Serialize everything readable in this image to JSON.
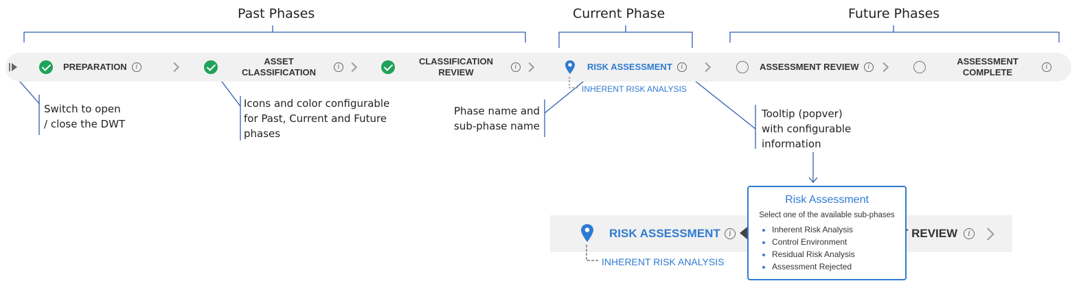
{
  "groups": {
    "past": "Past Phases",
    "current": "Current Phase",
    "future": "Future Phases"
  },
  "phases": [
    {
      "lines": [
        "PREPARATION"
      ],
      "status": "complete"
    },
    {
      "lines": [
        "ASSET",
        "CLASSIFICATION"
      ],
      "status": "complete"
    },
    {
      "lines": [
        "CLASSIFICATION",
        "REVIEW"
      ],
      "status": "complete"
    },
    {
      "lines": [
        "RISK ASSESSMENT"
      ],
      "status": "current",
      "sub_phase": "INHERENT RISK ANALYSIS"
    },
    {
      "lines": [
        "ASSESSMENT REVIEW"
      ],
      "status": "future"
    },
    {
      "lines": [
        "ASSESSMENT",
        "COMPLETE"
      ],
      "status": "future"
    }
  ],
  "annotations": {
    "switch": [
      "Switch to open",
      "/ close the DWT"
    ],
    "icons": [
      "Icons and color configurable",
      "for Past, Current and Future",
      "phases"
    ],
    "phase_name": [
      "Phase name and",
      "sub-phase name"
    ],
    "tooltip": [
      "Tooltip (popver)",
      "with configurable",
      "information"
    ]
  },
  "zoom": {
    "phase": "RISK ASSESSMENT",
    "sub_phase": "INHERENT RISK ANALYSIS",
    "next_partial": "T REVIEW"
  },
  "popover": {
    "title": "Risk Assessment",
    "description": "Select one of the available sub-phases",
    "items": [
      "Inherent Risk Analysis",
      "Control Environment",
      "Residual Risk Analysis",
      "Assessment Rejected"
    ]
  },
  "colors": {
    "accent": "#2f7bd1",
    "complete": "#1fa35a",
    "bar": "#f1f1f1"
  },
  "icons": {
    "toggle": "toggle-drawer-icon",
    "complete": "check-circle-icon",
    "current": "map-pin-icon",
    "future": "empty-circle-icon",
    "info": "info-icon",
    "separator": "chevron-right-icon"
  }
}
